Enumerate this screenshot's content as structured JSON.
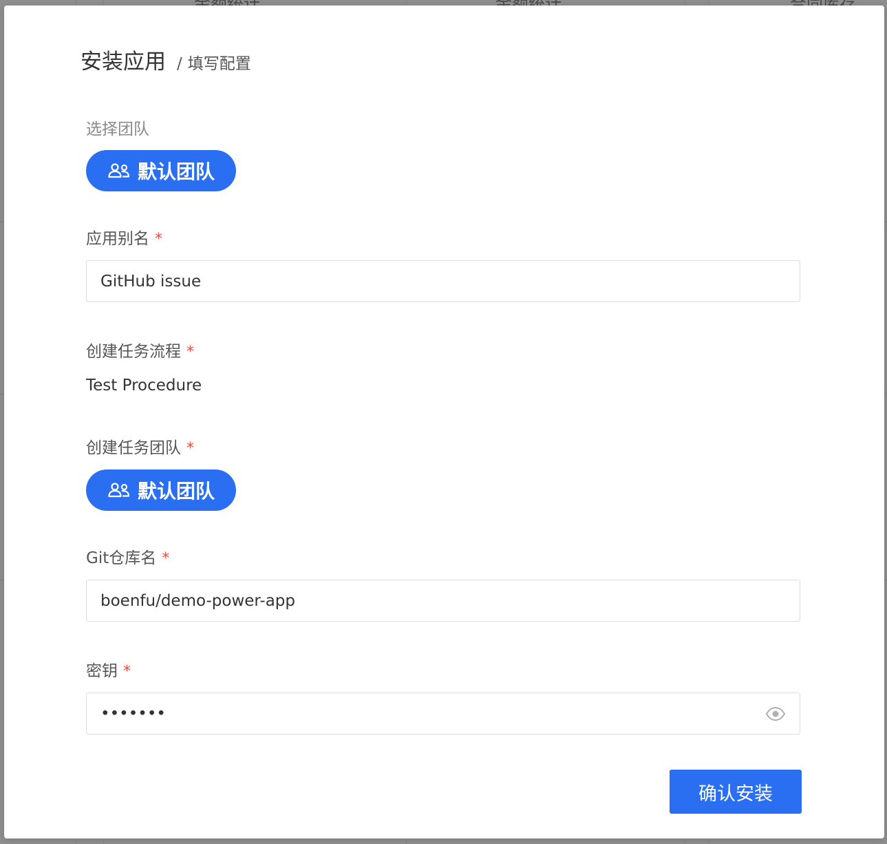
{
  "background": {
    "header_cells": [
      "金额统计",
      "金额统计",
      "合同库存"
    ]
  },
  "modal": {
    "title": "安装应用",
    "separator": "/",
    "subtitle": "填写配置"
  },
  "form": {
    "select_team": {
      "label": "选择团队",
      "value": "默认团队",
      "icon": "users-icon"
    },
    "app_alias": {
      "label": "应用别名",
      "required_mark": "*",
      "value": "GitHub issue"
    },
    "task_flow": {
      "label": "创建任务流程",
      "required_mark": "*",
      "value": "Test Procedure"
    },
    "task_team": {
      "label": "创建任务团队",
      "required_mark": "*",
      "value": "默认团队",
      "icon": "users-icon"
    },
    "git_repo": {
      "label": "Git仓库名",
      "required_mark": "*",
      "value": "boenfu/demo-power-app"
    },
    "secret": {
      "label": "密钥",
      "required_mark": "*",
      "value": "•••••••",
      "toggle_icon": "eye-icon"
    }
  },
  "actions": {
    "confirm_label": "确认安装"
  },
  "colors": {
    "primary": "#2a6ff2",
    "required": "#f04b3a",
    "overlay": "#8f8f8f"
  }
}
